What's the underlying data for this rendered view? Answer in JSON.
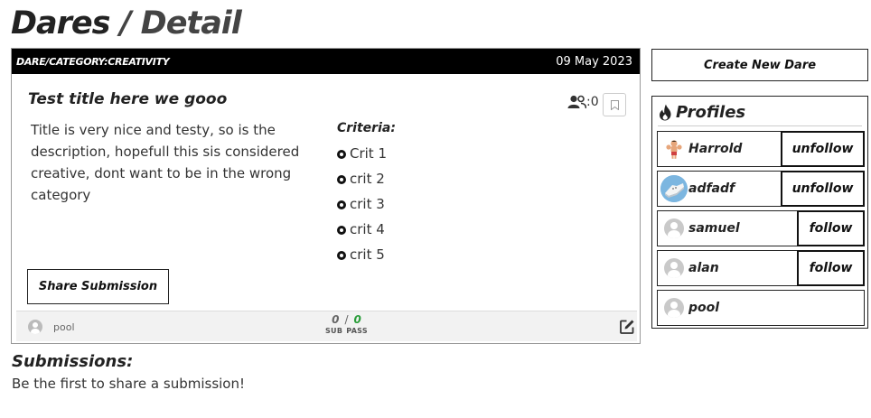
{
  "page": {
    "title_part1": "Dares",
    "title_part2": " / Detail"
  },
  "dare": {
    "category": "DARE/CATEGORY:CREATIVITY",
    "date": "09 May 2023",
    "title": "Test title here we gooo",
    "description": "Title is very nice and testy, so is the description, hopefull this sis considered creative, dont want to be in the wrong category",
    "participants_count": ":0",
    "criteria_title": "Criteria:",
    "criteria": [
      "Crit 1",
      "crit 2",
      "crit 3",
      "crit 4",
      "crit 5"
    ],
    "share_label": "Share Submission",
    "author": "pool",
    "submissions_count": "0",
    "stat_separator": "/",
    "pass_count": "0",
    "sub_label": "SUB",
    "pass_label": "PASS"
  },
  "submissions": {
    "title": "Submissions:",
    "empty_text": "Be the first to share a submission!"
  },
  "sidebar": {
    "create_label": "Create New Dare",
    "profiles_title": "Profiles",
    "profiles": [
      {
        "name": "Harrold",
        "action": "unfollow",
        "avatar": "harrold"
      },
      {
        "name": "adfadf",
        "action": "unfollow",
        "avatar": "adfadf"
      },
      {
        "name": "samuel",
        "action": "follow",
        "avatar": "default"
      },
      {
        "name": "alan",
        "action": "follow",
        "avatar": "default"
      },
      {
        "name": "pool",
        "action": "",
        "avatar": "default"
      }
    ]
  },
  "colors": {
    "header_bg": "#000000",
    "pass_green": "#2a9d3a"
  },
  "icons": [
    "users-icon",
    "bookmark-icon",
    "edit-icon",
    "fire-icon",
    "user-avatar-icon"
  ]
}
